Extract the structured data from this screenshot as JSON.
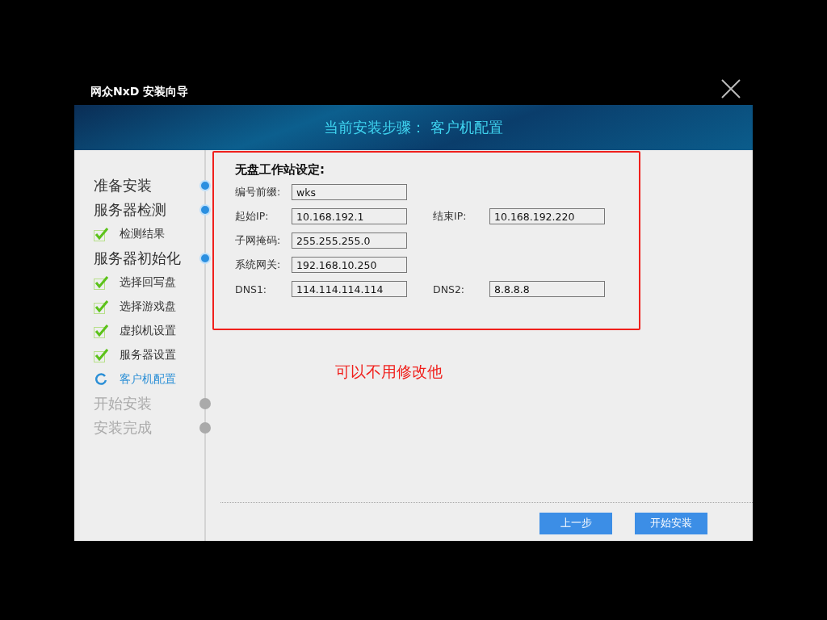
{
  "window": {
    "title": "网众NxD 安装向导"
  },
  "header": {
    "text": "当前安装步骤： 客户机配置"
  },
  "steps": [
    {
      "label": "准备安装",
      "kind": "major",
      "done": true,
      "current": false
    },
    {
      "label": "服务器检测",
      "kind": "major",
      "done": true,
      "current": false
    },
    {
      "label": "检测结果",
      "kind": "sub",
      "done": true,
      "current": false
    },
    {
      "label": "服务器初始化",
      "kind": "major",
      "done": true,
      "current": false
    },
    {
      "label": "选择回写盘",
      "kind": "sub",
      "done": true,
      "current": false
    },
    {
      "label": "选择游戏盘",
      "kind": "sub",
      "done": true,
      "current": false
    },
    {
      "label": "虚拟机设置",
      "kind": "sub",
      "done": true,
      "current": false
    },
    {
      "label": "服务器设置",
      "kind": "sub",
      "done": true,
      "current": false
    },
    {
      "label": "客户机配置",
      "kind": "sub",
      "done": false,
      "current": true
    },
    {
      "label": "开始安装",
      "kind": "major",
      "done": false,
      "current": false
    },
    {
      "label": "安装完成",
      "kind": "major",
      "done": false,
      "current": false
    }
  ],
  "form": {
    "title": "无盘工作站设定:",
    "rows": [
      [
        {
          "label": "编号前缀:",
          "value": "wks"
        }
      ],
      [
        {
          "label": "起始IP:",
          "value": "10.168.192.1"
        },
        {
          "label": "结束IP:",
          "value": "10.168.192.220"
        }
      ],
      [
        {
          "label": "子网掩码:",
          "value": "255.255.255.0"
        }
      ],
      [
        {
          "label": "系统网关:",
          "value": "192.168.10.250"
        }
      ],
      [
        {
          "label": "DNS1:",
          "value": "114.114.114.114"
        },
        {
          "label": "DNS2:",
          "value": "8.8.8.8"
        }
      ]
    ]
  },
  "annotation": {
    "text": "可以不用修改他"
  },
  "buttons": [
    "上一步",
    "开始安装"
  ]
}
